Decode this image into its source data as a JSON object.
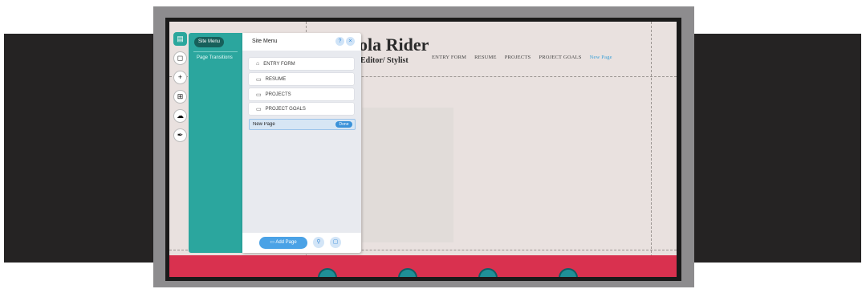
{
  "site": {
    "title": "ola Rider",
    "subtitle": "Editor/ Stylist",
    "nav": [
      "ENTRY FORM",
      "RESUME",
      "PROJECTS",
      "PROJECT GOALS",
      "New Page"
    ]
  },
  "editor": {
    "left_toolbar": [
      {
        "icon": "pages-icon",
        "glyph": "▤"
      },
      {
        "icon": "background-icon",
        "glyph": "◻"
      },
      {
        "icon": "add-icon",
        "glyph": "+"
      },
      {
        "icon": "app-market-icon",
        "glyph": "⊞"
      },
      {
        "icon": "upload-icon",
        "glyph": "☁"
      },
      {
        "icon": "pen-icon",
        "glyph": "✒"
      }
    ],
    "tabs": {
      "site_menu": "Site Menu",
      "page_transitions": "Page Transitions"
    },
    "panel": {
      "title": "Site Menu",
      "help_glyph": "?",
      "close_glyph": "×",
      "pages": [
        {
          "label": "ENTRY FORM",
          "icon": "home-icon",
          "glyph": "⌂"
        },
        {
          "label": "RESUME",
          "icon": "page-icon",
          "glyph": "▭"
        },
        {
          "label": "PROJECTS",
          "icon": "page-icon",
          "glyph": "▭"
        },
        {
          "label": "PROJECT GOALS",
          "icon": "page-icon",
          "glyph": "▭"
        }
      ],
      "new_page_value": "New Page",
      "done_label": "Done",
      "add_page_label": "Add Page",
      "add_link_glyph": "⚲",
      "add_folder_glyph": "▢"
    }
  },
  "colors": {
    "teal": "#2ba69e",
    "accent_blue": "#3b92d9",
    "footer_red": "#d9314f",
    "canvas_bg": "#e9e1df"
  }
}
